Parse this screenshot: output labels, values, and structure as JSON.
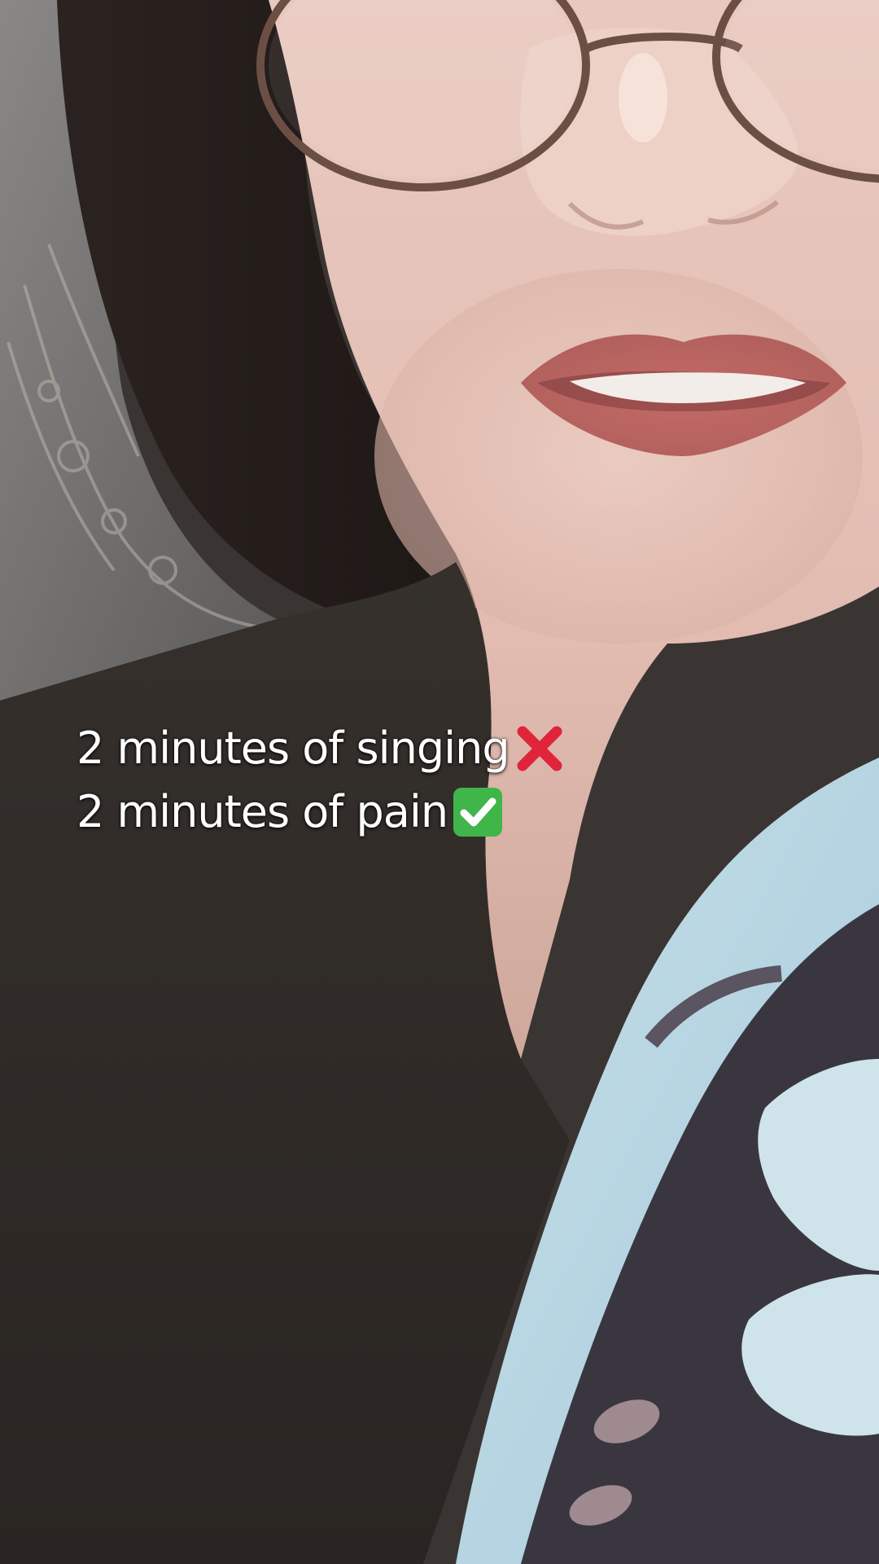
{
  "caption": {
    "line1_text": "2 minutes of singing",
    "line1_icon": "red-cross-mark-icon",
    "line2_text": "2 minutes of pain",
    "line2_icon": "green-check-mark-icon"
  },
  "colors": {
    "text": "#ffffff",
    "cross": "#e0243a",
    "check_bg": "#3fb54a",
    "check_mark": "#ffffff"
  }
}
